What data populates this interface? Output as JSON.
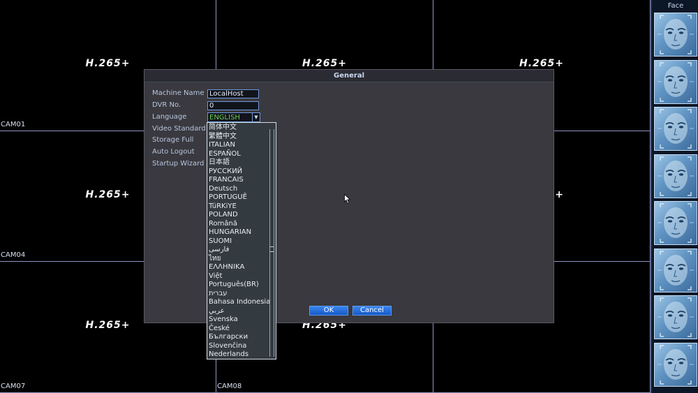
{
  "grid": {
    "codec": "H.265+",
    "cells": [
      {
        "label": ""
      },
      {
        "label": ""
      },
      {
        "label": ""
      },
      {
        "label": "CAM01"
      },
      {
        "label": ""
      },
      {
        "label": ""
      },
      {
        "label": "CAM04"
      },
      {
        "label": ""
      },
      {
        "label": ""
      },
      {
        "label": "CAM07"
      },
      {
        "label": "CAM08"
      },
      {
        "label": ""
      }
    ]
  },
  "face_panel": {
    "title": "Face",
    "count": 8,
    "icon": "face-thumbnail-icon"
  },
  "dialog": {
    "title": "General",
    "fields": {
      "machine_name": {
        "label": "Machine Name",
        "value": "LocalHost"
      },
      "dvr_no": {
        "label": "DVR No.",
        "value": "0"
      },
      "language": {
        "label": "Language",
        "value": "ENGLISH"
      },
      "video_standard": {
        "label": "Video Standard"
      },
      "storage_full": {
        "label": "Storage Full"
      },
      "auto_logout": {
        "label": "Auto Logout"
      },
      "startup_wizard": {
        "label": "Startup Wizard"
      }
    },
    "ok_label": "OK",
    "cancel_label": "Cancel"
  },
  "language_options": [
    "简体中文",
    "繁體中文",
    "ITALIAN",
    "ESPAÑOL",
    "日本語",
    "РУССКИЙ",
    "FRANCAIS",
    "Deutsch",
    "PORTUGUÊ",
    "TüRKiYE",
    "POLAND",
    "Română",
    "HUNGARIAN",
    "SUOMI",
    "فارسی",
    "ไทย",
    "ΕΛΛΗΝΙΚΑ",
    "Việt",
    "Português(BR)",
    "עברית",
    "Bahasa Indonesia",
    "عربي",
    "Svenska",
    "České",
    "Български",
    "Slovenčina",
    "Nederlands"
  ],
  "colors": {
    "grid_line": "#8f95c4",
    "language_value": "#66d24a",
    "button": "#1f6fe0"
  }
}
